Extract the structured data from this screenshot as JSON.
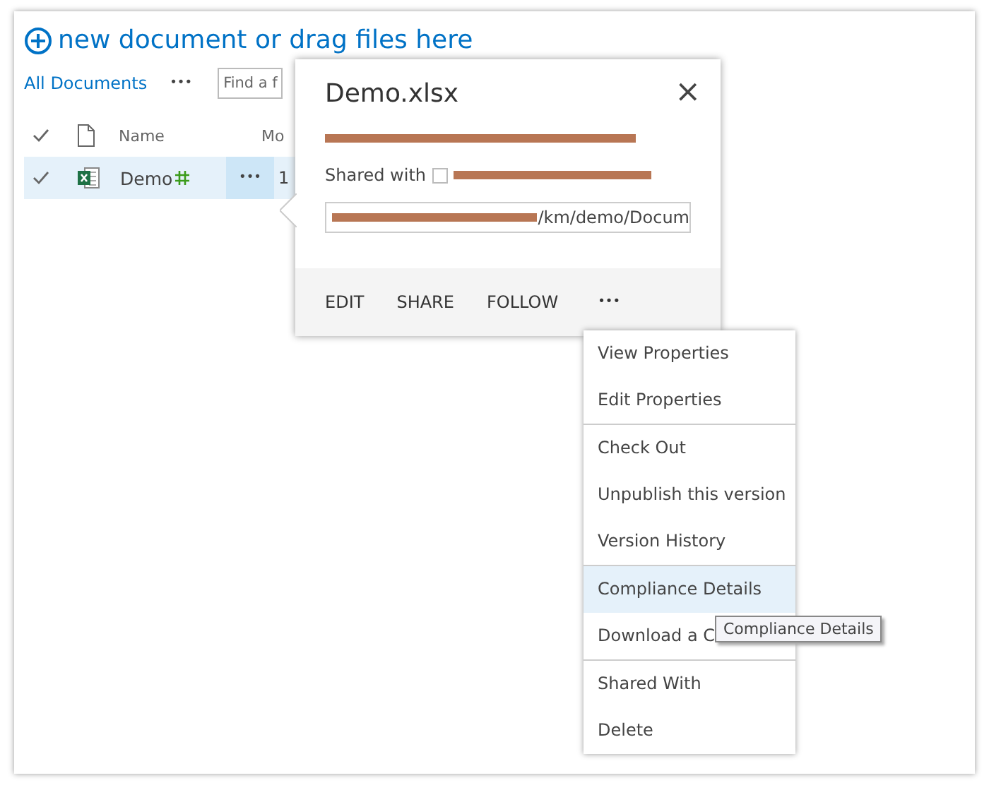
{
  "library": {
    "new_document": "new document or drag files here",
    "view": "All Documents",
    "view_menu": "•••",
    "search": {
      "placeholder": "Find a f"
    },
    "columns": [
      {
        "kind": "check"
      },
      {
        "kind": "type"
      },
      {
        "kind": "text",
        "label": "Name"
      },
      {
        "kind": "text",
        "label": "Mo"
      }
    ],
    "rows": [
      {
        "name": "Demo",
        "is_new": true,
        "selected": true,
        "menu": "•••",
        "column_3": "1"
      }
    ]
  },
  "callout": {
    "title": "Demo.xlsx",
    "close": "×",
    "changed_redacted": true,
    "shared_label": "Shared with",
    "url": "/km/demo/Docum",
    "actions": [
      "EDIT",
      "SHARE",
      "FOLLOW",
      "•••"
    ]
  },
  "menu": {
    "sections": [
      [
        {
          "label": "View Properties",
          "highlighted": false
        },
        {
          "label": "Edit Properties",
          "highlighted": false
        }
      ],
      [
        {
          "label": "Check Out",
          "highlighted": false
        },
        {
          "label": "Unpublish this version",
          "highlighted": false
        },
        {
          "label": "Version History",
          "highlighted": false
        }
      ],
      [
        {
          "label": "Compliance Details",
          "highlighted": true
        },
        {
          "label": "Download a C",
          "highlighted": false
        }
      ],
      [
        {
          "label": "Shared With",
          "highlighted": false
        },
        {
          "label": "Delete",
          "highlighted": false
        }
      ]
    ]
  },
  "tooltip": "Compliance Details"
}
